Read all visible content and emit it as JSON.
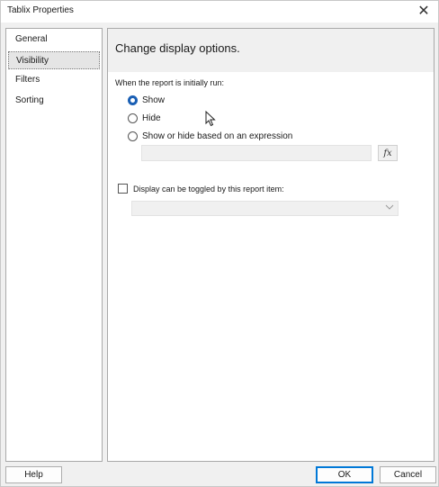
{
  "window": {
    "title": "Tablix Properties",
    "close_glyph": "✕"
  },
  "nav": {
    "items": [
      {
        "label": "General",
        "selected": false
      },
      {
        "label": "Visibility",
        "selected": true
      },
      {
        "label": "Filters",
        "selected": false
      },
      {
        "label": "Sorting",
        "selected": false
      }
    ]
  },
  "panel": {
    "heading": "Change display options.",
    "section_label": "When the report is initially run:",
    "options": {
      "show": "Show",
      "hide": "Hide",
      "expression": "Show or hide based on an expression"
    },
    "selected_option": "Show",
    "expression_value": "",
    "fx_label": "fx",
    "toggle_label": "Display can be toggled by this report item:",
    "toggle_checked": false,
    "toggle_value": ""
  },
  "footer": {
    "help_label": "Help",
    "ok_label": "OK",
    "cancel_label": "Cancel"
  },
  "colors": {
    "accent": "#0078d7",
    "radio_checked": "#1a5fb4"
  }
}
